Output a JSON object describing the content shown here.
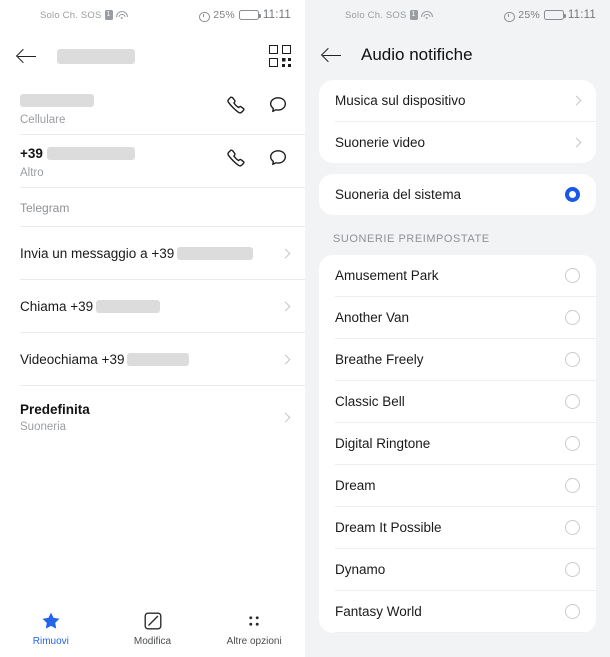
{
  "status_bar": {
    "carrier": "Solo Ch. SOS",
    "sim_icon": "sim-card-icon",
    "wifi_icon": "wifi-icon",
    "alarm_icon": "alarm-clock-icon",
    "battery_percent": "25%",
    "battery_icon": "battery-icon",
    "time": "11:11"
  },
  "contact_screen": {
    "back_icon": "back-arrow-icon",
    "title_redacted": true,
    "qr_icon": "qr-code-icon",
    "phone_numbers": [
      {
        "prefix": "",
        "number_redacted": true,
        "type_label": "Cellulare",
        "call_icon": "phone-icon",
        "message_icon": "message-bubble-icon"
      },
      {
        "prefix": "+39",
        "number_redacted": true,
        "type_label": "Altro",
        "call_icon": "phone-icon",
        "message_icon": "message-bubble-icon"
      }
    ],
    "telegram_section": {
      "header": "Telegram",
      "actions": [
        {
          "label": "Invia un messaggio a +39",
          "redacted_suffix": true
        },
        {
          "label": "Chiama +39",
          "redacted_suffix": true
        },
        {
          "label": "Videochiama +39",
          "redacted_suffix": true
        }
      ]
    },
    "ringtone_row": {
      "title": "Predefinita",
      "subtitle": "Suoneria"
    },
    "bottom_bar": [
      {
        "label": "Rimuovi",
        "icon": "star-icon",
        "active": true
      },
      {
        "label": "Modifica",
        "icon": "edit-pencil-icon",
        "active": false
      },
      {
        "label": "Altre opzioni",
        "icon": "more-options-icon",
        "active": false
      }
    ]
  },
  "audio_screen": {
    "back_icon": "back-arrow-icon",
    "title": "Audio notifiche",
    "source_options": [
      {
        "label": "Musica sul dispositivo",
        "chevron": true
      },
      {
        "label": "Suonerie video",
        "chevron": true
      }
    ],
    "system_option": {
      "label": "Suoneria del sistema",
      "selected": true
    },
    "preset_header": "SUONERIE PREIMPOSTATE",
    "presets": [
      {
        "label": "Amusement Park",
        "selected": false
      },
      {
        "label": "Another Van",
        "selected": false
      },
      {
        "label": "Breathe Freely",
        "selected": false
      },
      {
        "label": "Classic Bell",
        "selected": false
      },
      {
        "label": "Digital Ringtone",
        "selected": false
      },
      {
        "label": "Dream",
        "selected": false
      },
      {
        "label": "Dream It Possible",
        "selected": false
      },
      {
        "label": "Dynamo",
        "selected": false
      },
      {
        "label": "Fantasy World",
        "selected": false
      }
    ]
  },
  "colors": {
    "accent_blue": "#1a56e8",
    "tab_blue": "#2463eb",
    "panel_background": "#f1f3f5",
    "card_background": "#ffffff",
    "text_primary": "#1a1a1a",
    "text_secondary": "#9b9ea2"
  }
}
